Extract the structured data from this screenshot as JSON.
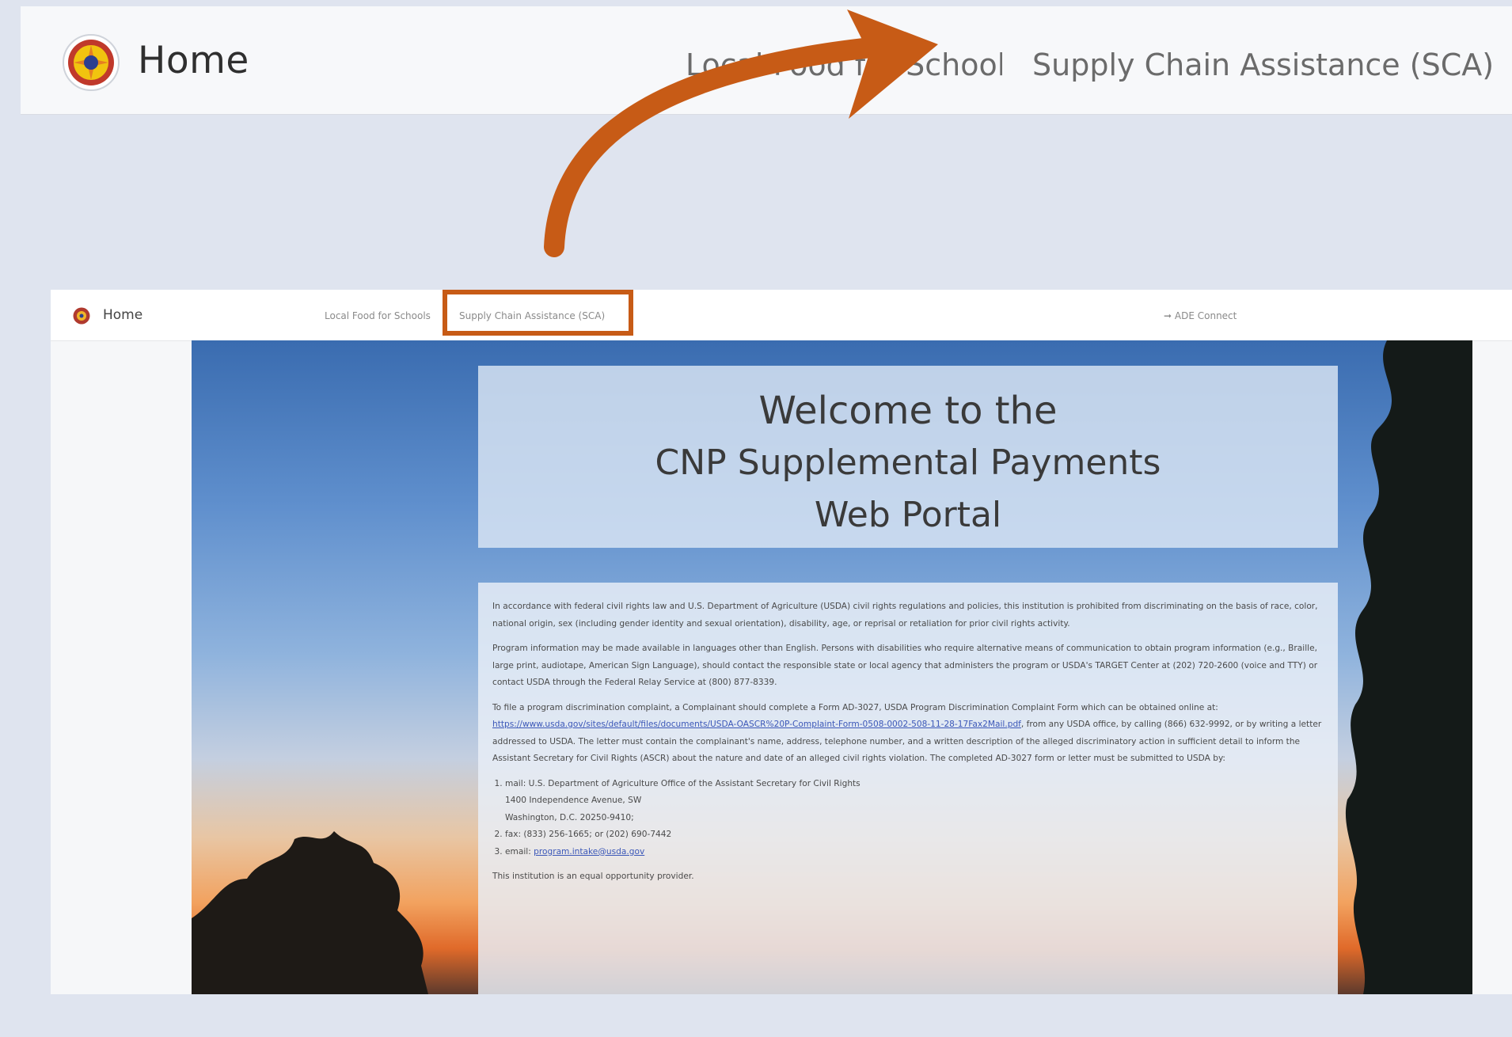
{
  "zoomed_header": {
    "home_label": "Home",
    "local_food_label": "Local Food for Schools",
    "sca_label": "Supply Chain Assistance (SCA)"
  },
  "screenshot": {
    "nav": {
      "home_label": "Home",
      "local_food_label": "Local Food for Schools",
      "sca_label": "Supply Chain Assistance (SCA)",
      "connect_label": "ADE Connect"
    },
    "welcome": {
      "line1": "Welcome to the",
      "line2": "CNP Supplemental Payments",
      "line3": "Web Portal"
    },
    "statement": {
      "p1": "In accordance with federal civil rights law and U.S. Department of Agriculture (USDA) civil rights regulations and policies, this institution is prohibited from discriminating on the basis of race, color, national origin, sex (including gender identity and sexual orientation), disability, age, or reprisal or retaliation for prior civil rights activity.",
      "p2": "Program information may be made available in languages other than English. Persons with disabilities who require alternative means of communication to obtain program information (e.g., Braille, large print, audiotape, American Sign Language), should contact the responsible state or local agency that administers the program or USDA's TARGET Center at (202) 720-2600 (voice and TTY) or contact USDA through the Federal Relay Service at (800) 877-8339.",
      "p3_before": "To file a program discrimination complaint, a Complainant should complete a Form AD-3027, USDA Program Discrimination Complaint Form which can be obtained online at: ",
      "p3_link": "https://www.usda.gov/sites/default/files/documents/USDA-OASCR%20P-Complaint-Form-0508-0002-508-11-28-17Fax2Mail.pdf",
      "p3_after": ", from any USDA office, by calling (866) 632-9992, or by writing a letter addressed to USDA. The letter must contain the complainant's name, address, telephone number, and a written description of the alleged discriminatory action in sufficient detail to inform the Assistant Secretary for Civil Rights (ASCR) about the nature and date of an alleged civil rights violation. The completed AD-3027 form or letter must be submitted to USDA by:",
      "mail_line1": "mail: U.S. Department of Agriculture Office of the Assistant Secretary for Civil Rights",
      "mail_line2": "1400 Independence Avenue, SW",
      "mail_line3": "Washington, D.C. 20250-9410;",
      "fax_line": "fax: (833) 256-1665; or (202) 690-7442",
      "email_prefix": "email: ",
      "email_link": "program.intake@usda.gov",
      "closing": "This institution is an equal opportunity provider."
    }
  },
  "colors": {
    "page_bg": "#dfe4ef",
    "arrow": "#c75b16",
    "highlight_box": "#c75b16",
    "link": "#3b57b8"
  },
  "icons": {
    "logo": "ade-seal-icon",
    "connect": "sign-in-icon",
    "annotation": "curved-arrow-icon"
  }
}
